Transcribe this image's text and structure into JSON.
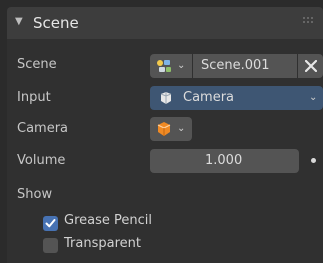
{
  "panel": {
    "title": "Scene",
    "collapse_icon": "triangle-down-icon"
  },
  "rows": {
    "scene": {
      "label": "Scene",
      "value": "Scene.001",
      "icon": "scene-icon",
      "close_icon": "close-icon"
    },
    "input": {
      "label": "Input",
      "value": "Camera",
      "icon": "camera-object-icon"
    },
    "camera": {
      "label": "Camera",
      "icon": "object-cube-icon"
    },
    "volume": {
      "label": "Volume",
      "value": "1.000"
    }
  },
  "show": {
    "label": "Show",
    "options": [
      {
        "label": "Grease Pencil",
        "checked": true
      },
      {
        "label": "Transparent",
        "checked": false
      }
    ]
  },
  "colors": {
    "accent": "#4772b3",
    "input_field": "#3e5673",
    "field": "#545454"
  }
}
